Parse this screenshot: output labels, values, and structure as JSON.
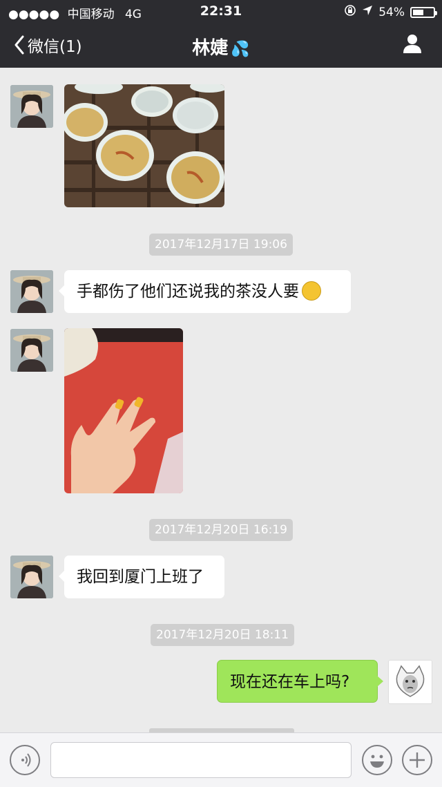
{
  "status_bar": {
    "signal": "●●●●●",
    "carrier": "中国移动",
    "network": "4G",
    "time": "22:31",
    "battery_percent": "54%",
    "battery_level": 0.54
  },
  "nav": {
    "back_label": "微信(1)",
    "title": "林婕",
    "title_emoji": "💦"
  },
  "messages": {
    "ts1": "2017年12月17日 19:06",
    "msg1": "手都伤了他们还说我的茶没人要",
    "ts2": "2017年12月20日 16:19",
    "msg2": "我回到厦门上班了",
    "ts3": "2017年12月20日 18:11",
    "msg3": "现在还在车上吗?"
  },
  "colors": {
    "nav_bg": "#2c2c30",
    "chat_bg": "#ebebeb",
    "sent_bubble": "#9fe55a",
    "received_bubble": "#ffffff"
  }
}
